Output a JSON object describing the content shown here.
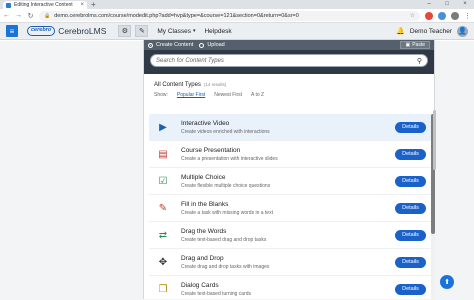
{
  "browser": {
    "tab_title": "Editing Interactive Content",
    "tab_close": "×",
    "new_tab": "+",
    "window_controls": [
      "–",
      "□",
      "×"
    ],
    "url": "demo.cerebrolms.com/course/modedit.php?add=hvp&type=&course=121&section=0&return=0&sr=0",
    "nav": {
      "back": "←",
      "forward": "→",
      "reload": "↻"
    },
    "lock": "🔒",
    "star": "☆",
    "menu": "⋮"
  },
  "app": {
    "menu_icon": "≡",
    "logo_mark": "cerebro",
    "logo_text": "CerebroLMS",
    "tool_buttons": [
      "⚙",
      "✎"
    ],
    "nav": [
      {
        "label": "My Classes",
        "caret": "▾"
      },
      {
        "label": "Helpdesk",
        "caret": ""
      }
    ],
    "bell": "🔔",
    "user_name": "Demo Teacher",
    "avatar": "👤"
  },
  "editor": {
    "create_label": "Create Content",
    "upload_label": "Upload",
    "paste_label": "Paste",
    "search_placeholder": "Search for Content Types",
    "search_icon": "⚲",
    "all_types_title": "All Content Types",
    "count_label": "(14 results)",
    "show_label": "Show:",
    "sort_options": [
      "Popular First",
      "Newest First",
      "A to Z"
    ],
    "details_label": "Details"
  },
  "content_types": [
    {
      "name": "Interactive Video",
      "desc": "Create videos enriched with interactions",
      "icon": "▶",
      "color": "#1b5fb3"
    },
    {
      "name": "Course Presentation",
      "desc": "Create a presentation with interactive slides",
      "icon": "▤",
      "color": "#c0392b"
    },
    {
      "name": "Multiple Choice",
      "desc": "Create flexible multiple choice questions",
      "icon": "☑",
      "color": "#2e8b57"
    },
    {
      "name": "Fill in the Blanks",
      "desc": "Create a task with missing words in a text",
      "icon": "✎",
      "color": "#c0392b"
    },
    {
      "name": "Drag the Words",
      "desc": "Create text-based drag and drop tasks",
      "icon": "⇄",
      "color": "#2e8b57"
    },
    {
      "name": "Drag and Drop",
      "desc": "Create drag and drop tasks with images",
      "icon": "✥",
      "color": "#333333"
    },
    {
      "name": "Dialog Cards",
      "desc": "Create text-based turning cards",
      "icon": "❐",
      "color": "#b8860b"
    }
  ],
  "fab_icon": "⬆"
}
